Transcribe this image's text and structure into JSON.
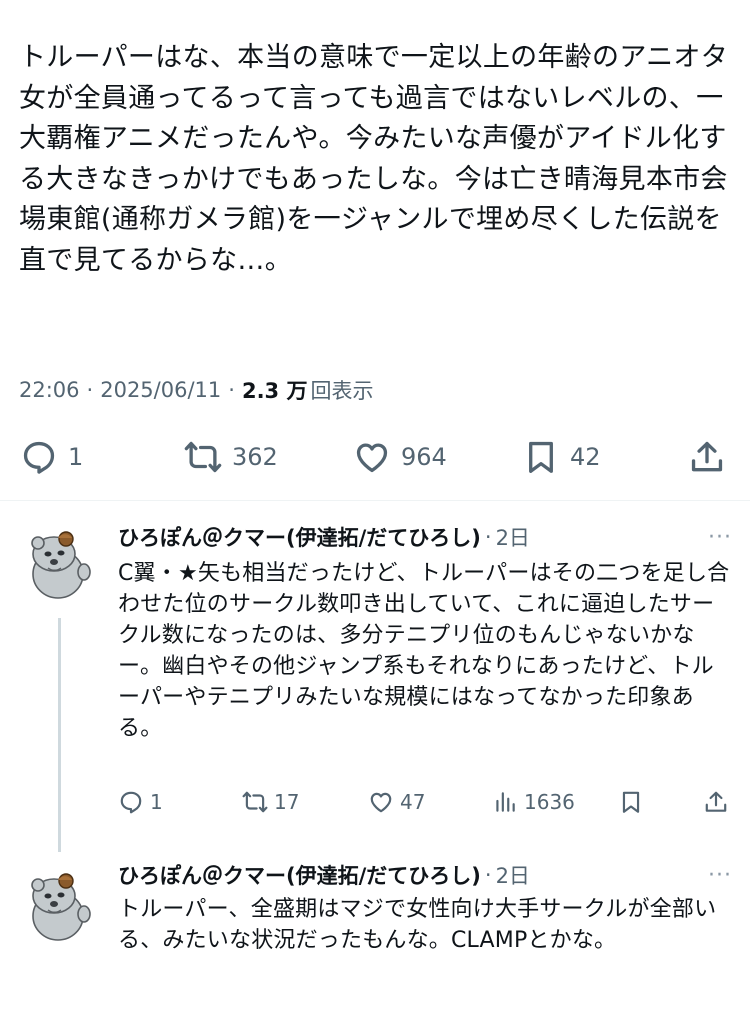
{
  "tweet": {
    "text": "トルーパーはな、本当の意味で一定以上の年齢のアニオタ女が全員通ってるって言っても過言ではないレベルの、一大覇権アニメだったんや。今みたいな声優がアイドル化する大きなきっかけでもあったしな。今は亡き晴海見本市会場東館(通称ガメラ館)を一ジャンルで埋め尽くした伝説を直で見てるからな…。",
    "time": "22:06",
    "date": "2025/06/11",
    "views_count": "2.3 万",
    "views_label": "回表示",
    "sep": "·",
    "actions": {
      "reply_count": "1",
      "retweet_count": "362",
      "like_count": "964",
      "bookmark_count": "42"
    }
  },
  "replies": [
    {
      "name": "ひろぽん＠クマー(伊達拓/だてひろし)",
      "time": "2日",
      "dot": "·",
      "more": "···",
      "text": "C翼・★矢も相当だったけど、トルーパーはその二つを足し合わせた位のサークル数叩き出していて、これに逼迫したサークル数になったのは、多分テニプリ位のもんじゃないかなー。幽白やその他ジャンプ系もそれなりにあったけど、トルーパーやテニプリみたいな規模にはなってなかった印象ある。",
      "reply_count": "1",
      "retweet_count": "17",
      "like_count": "47",
      "views_count": "1636"
    },
    {
      "name": "ひろぽん＠クマー(伊達拓/だてひろし)",
      "time": "2日",
      "dot": "·",
      "more": "···",
      "text": "トルーパー、全盛期はマジで女性向け大手サークルが全部いる、みたいな状況だったもんな。CLAMPとかな。"
    }
  ],
  "icons": [
    "reply-icon",
    "retweet-icon",
    "like-icon",
    "bookmark-icon",
    "share-icon",
    "views-icon",
    "more-icon",
    "avatar"
  ],
  "colors": {
    "text": "#0f1419",
    "secondary": "#536471",
    "divider": "#eff3f4",
    "thread_line": "#cfd9de"
  }
}
